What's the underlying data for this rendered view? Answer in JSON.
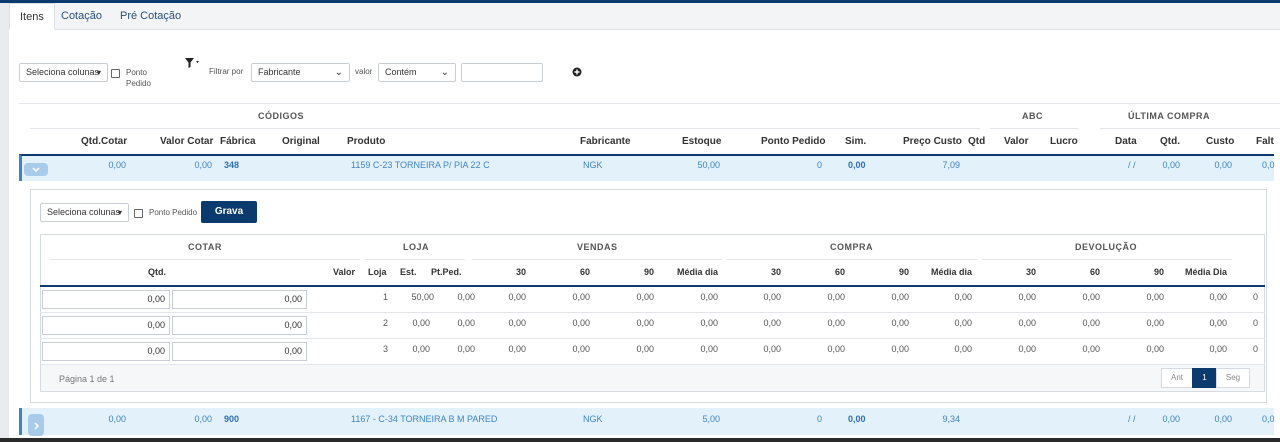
{
  "tabs": [
    "Itens",
    "Cotação",
    "Pré Cotação"
  ],
  "toolbar": {
    "select_columns": "Seleciona colunas",
    "ponto_pedido_line1": "Ponto",
    "ponto_pedido_line2": "Pedido",
    "filter_by_label": "Filtrar por",
    "filter_field": "Fabricante",
    "value_label": "valor",
    "operator": "Contém",
    "filter_value": ""
  },
  "main_table": {
    "groups": {
      "codigos": "CÓDIGOS",
      "abc": "ABC",
      "ultima_compra": "ÚLTIMA COMPRA"
    },
    "headers": {
      "qtd_cotar": "Qtd.Cotar",
      "valor_cotar": "Valor Cotar",
      "fabrica": "Fábrica",
      "original": "Original",
      "produto": "Produto",
      "fabricante": "Fabricante",
      "estoque": "Estoque",
      "ponto_pedido": "Ponto Pedido",
      "sim": "Sim.",
      "preco_custo": "Preço Custo",
      "qtd": "Qtd",
      "valor": "Valor",
      "lucro": "Lucro",
      "data": "Data",
      "qtd2": "Qtd.",
      "custo": "Custo",
      "falt": "Falt"
    },
    "rows": [
      {
        "qtd_cotar": "0,00",
        "valor_cotar": "0,00",
        "fabrica": "348",
        "produto": "1159 C-23 TORNEIRA P/ PIA 22 C",
        "fabricante": "NGK",
        "estoque": "50,00",
        "ponto_pedido": "0",
        "sim": "0,00",
        "preco_custo": "7,09",
        "data": "/ /",
        "qtd": "0,00",
        "custo": "0,00",
        "falt": "0,0"
      },
      {
        "qtd_cotar": "0,00",
        "valor_cotar": "0,00",
        "fabrica": "900",
        "produto": "1167 - C-34 TORNEIRA B M PARED",
        "fabricante": "NGK",
        "estoque": "5,00",
        "ponto_pedido": "0",
        "sim": "0,00",
        "preco_custo": "9,34",
        "data": "/ /",
        "qtd": "0,00",
        "custo": "0,00",
        "falt": "0,0"
      }
    ]
  },
  "detail": {
    "select_columns": "Seleciona colunas",
    "ponto_pedido": "Ponto Pedido",
    "grava": "Grava",
    "groups": {
      "cotar": "COTAR",
      "loja": "LOJA",
      "vendas": "VENDAS",
      "compra": "COMPRA",
      "devolucao": "DEVOLUÇÃO"
    },
    "headers": {
      "qtd": "Qtd.",
      "valor": "Valor",
      "loja": "Loja",
      "est": "Est.",
      "ptped": "Pt.Ped.",
      "v30": "30",
      "v60": "60",
      "v90": "90",
      "vmedia": "Média dia",
      "c30": "30",
      "c60": "60",
      "c90": "90",
      "cmedia": "Média dia",
      "d30": "30",
      "d60": "60",
      "d90": "90",
      "dmedia": "Média Dia"
    },
    "rows": [
      {
        "qtd": "0,00",
        "valor": "0,00",
        "loja": "1",
        "est": "50,00",
        "ptped": "0,00",
        "v30": "0,00",
        "v60": "0,00",
        "v90": "0,00",
        "vmedia": "0,00",
        "c30": "0,00",
        "c60": "0,00",
        "c90": "0,00",
        "cmedia": "0,00",
        "d30": "0,00",
        "d60": "0,00",
        "d90": "0,00",
        "dmedia": "0,00",
        "extra": "0"
      },
      {
        "qtd": "0,00",
        "valor": "0,00",
        "loja": "2",
        "est": "0,00",
        "ptped": "0,00",
        "v30": "0,00",
        "v60": "0,00",
        "v90": "0,00",
        "vmedia": "0,00",
        "c30": "0,00",
        "c60": "0,00",
        "c90": "0,00",
        "cmedia": "0,00",
        "d30": "0,00",
        "d60": "0,00",
        "d90": "0,00",
        "dmedia": "0,00",
        "extra": "0"
      },
      {
        "qtd": "0,00",
        "valor": "0,00",
        "loja": "3",
        "est": "0,00",
        "ptped": "0,00",
        "v30": "0,00",
        "v60": "0,00",
        "v90": "0,00",
        "vmedia": "0,00",
        "c30": "0,00",
        "c60": "0,00",
        "c90": "0,00",
        "cmedia": "0,00",
        "d30": "0,00",
        "d60": "0,00",
        "d90": "0,00",
        "dmedia": "0,00",
        "extra": "0"
      }
    ],
    "page_info": "Página 1 de 1",
    "pagination": {
      "prev": "Ant",
      "current": "1",
      "next": "Seg"
    }
  },
  "icons": {
    "filter": "filter-icon",
    "add": "add-circle-icon",
    "expand": "chevron-down-icon",
    "collapsed": "chevron-right-icon"
  },
  "colors": {
    "accent": "#0b3a6e",
    "row_highlight": "#e3f1fb",
    "link_blue": "#3f84c5"
  }
}
